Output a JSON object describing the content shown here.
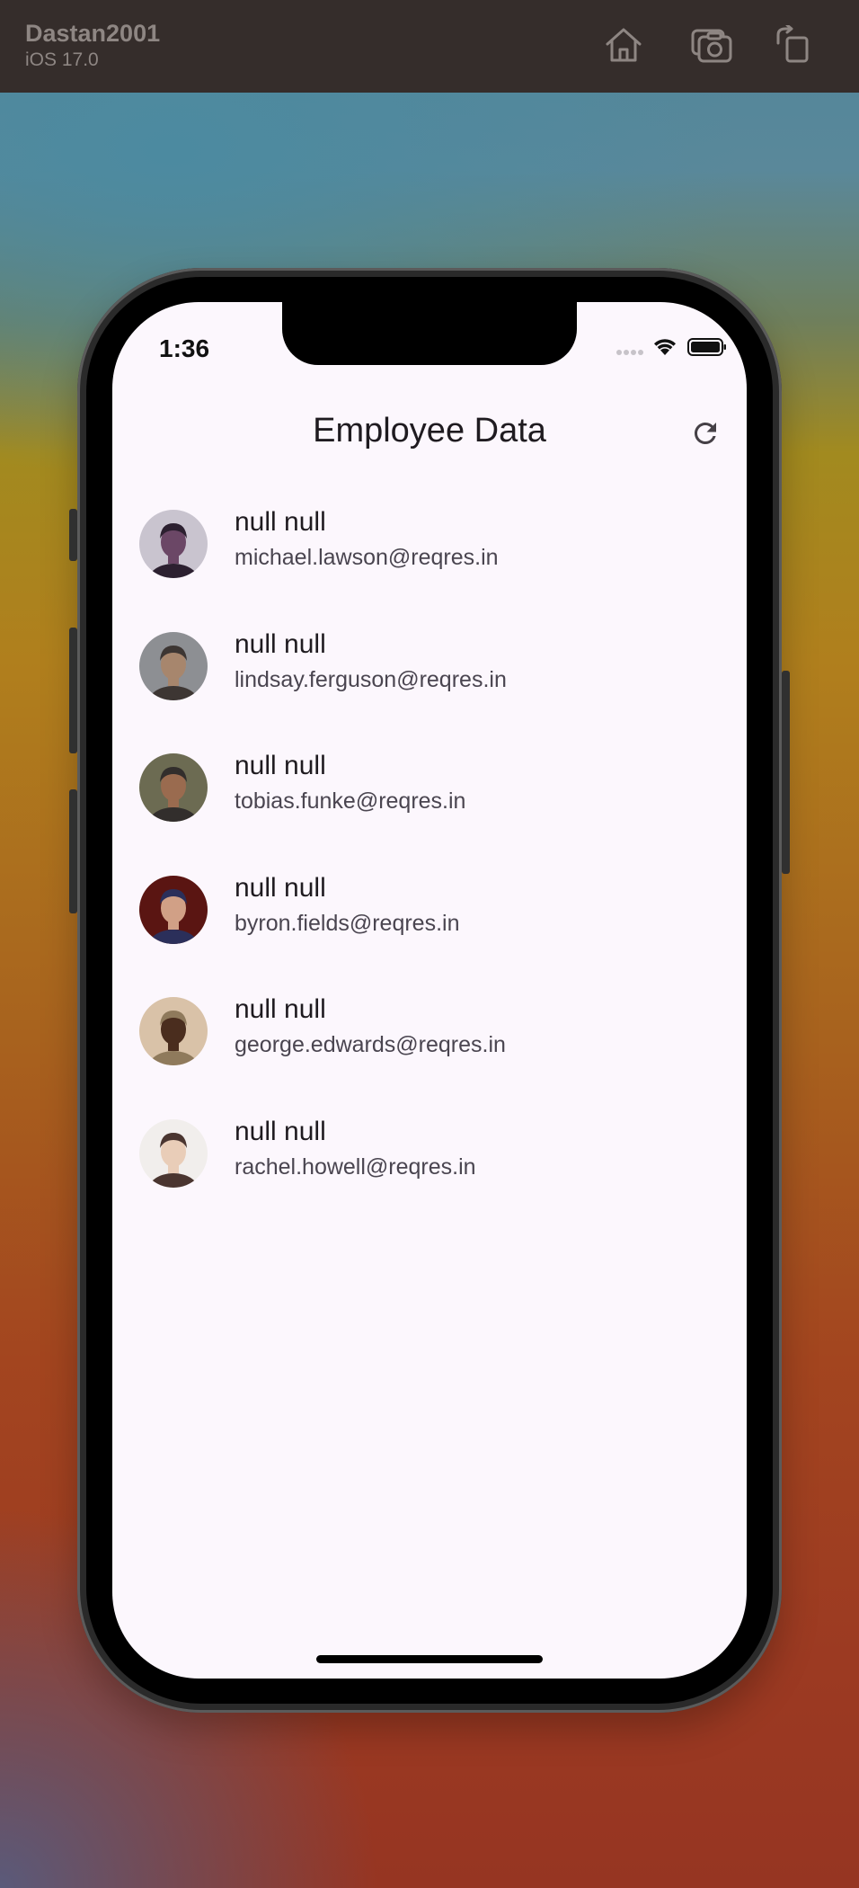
{
  "simulator": {
    "device_name": "Dastan2001",
    "os_version": "iOS 17.0",
    "toolbar": [
      {
        "icon": "home-icon"
      },
      {
        "icon": "screenshot-icon"
      },
      {
        "icon": "rotate-icon"
      }
    ]
  },
  "status_bar": {
    "time": "1:36"
  },
  "app": {
    "title": "Employee Data",
    "refresh_icon": "refresh-icon"
  },
  "employees": [
    {
      "name": "null null",
      "email": "michael.lawson@reqres.in",
      "avatar_colors": [
        "#6b4766",
        "#2c2030",
        "#c9c4cf"
      ]
    },
    {
      "name": "null null",
      "email": "lindsay.ferguson@reqres.in",
      "avatar_colors": [
        "#a7866d",
        "#3d3633",
        "#8d8f93"
      ]
    },
    {
      "name": "null null",
      "email": "tobias.funke@reqres.in",
      "avatar_colors": [
        "#9a6b4f",
        "#322e2c",
        "#6c6b52"
      ]
    },
    {
      "name": "null null",
      "email": "byron.fields@reqres.in",
      "avatar_colors": [
        "#d1a086",
        "#2b2f5a",
        "#5a1512"
      ]
    },
    {
      "name": "null null",
      "email": "george.edwards@reqres.in",
      "avatar_colors": [
        "#4a2d1e",
        "#8f7a5c",
        "#d9c2a8"
      ]
    },
    {
      "name": "null null",
      "email": "rachel.howell@reqres.in",
      "avatar_colors": [
        "#e9cdb8",
        "#4a3530",
        "#f1eeec"
      ]
    }
  ]
}
